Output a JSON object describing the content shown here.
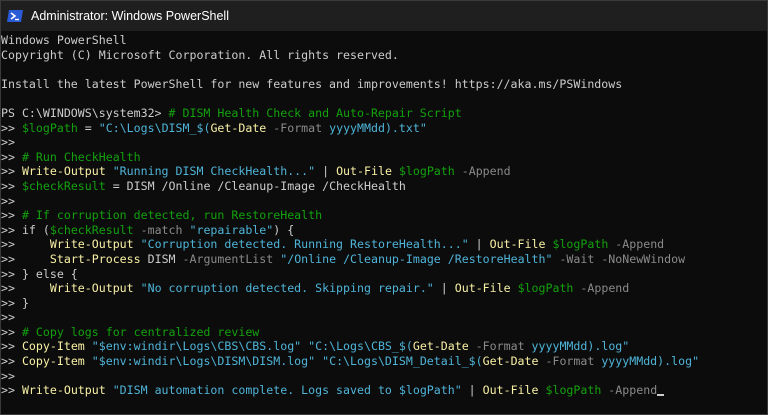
{
  "window": {
    "title": "Administrator: Windows PowerShell"
  },
  "colors": {
    "background": "#0c0c0c",
    "text": "#cccccc",
    "string": "#4fb4d8",
    "comment": "#13a10e",
    "command": "#f9f1a5",
    "parameter": "#8a8a8a",
    "variable": "#13a10e"
  },
  "console": {
    "lines": [
      [
        {
          "t": "Windows PowerShell",
          "c": "default"
        }
      ],
      [
        {
          "t": "Copyright (C) Microsoft Corporation. All rights reserved.",
          "c": "default"
        }
      ],
      [],
      [
        {
          "t": "Install the latest PowerShell for new features and improvements! https://aka.ms/PSWindows",
          "c": "default"
        }
      ],
      [],
      [
        {
          "t": "PS C:\\WINDOWS\\system32> ",
          "c": "default"
        },
        {
          "t": "# DISM Health Check and Auto-Repair Script",
          "c": "comment"
        }
      ],
      [
        {
          "t": ">> ",
          "c": "default"
        },
        {
          "t": "$logPath",
          "c": "var"
        },
        {
          "t": " = ",
          "c": "op"
        },
        {
          "t": "\"C:\\Logs\\DISM_$(",
          "c": "string"
        },
        {
          "t": "Get-Date",
          "c": "cmd"
        },
        {
          "t": " -Format",
          "c": "param"
        },
        {
          "t": " yyyyMMdd",
          "c": "string"
        },
        {
          "t": ").txt\"",
          "c": "string"
        }
      ],
      [
        {
          "t": ">>",
          "c": "default"
        }
      ],
      [
        {
          "t": ">> ",
          "c": "default"
        },
        {
          "t": "# Run CheckHealth",
          "c": "comment"
        }
      ],
      [
        {
          "t": ">> ",
          "c": "default"
        },
        {
          "t": "Write-Output",
          "c": "cmd"
        },
        {
          "t": " \"Running DISM CheckHealth...\"",
          "c": "string"
        },
        {
          "t": " | ",
          "c": "op"
        },
        {
          "t": "Out-File",
          "c": "cmd"
        },
        {
          "t": " $logPath",
          "c": "var"
        },
        {
          "t": " -Append",
          "c": "param"
        }
      ],
      [
        {
          "t": ">> ",
          "c": "default"
        },
        {
          "t": "$checkResult",
          "c": "var"
        },
        {
          "t": " = DISM /Online /Cleanup-Image /CheckHealth",
          "c": "op"
        }
      ],
      [
        {
          "t": ">>",
          "c": "default"
        }
      ],
      [
        {
          "t": ">> ",
          "c": "default"
        },
        {
          "t": "# If corruption detected, run RestoreHealth",
          "c": "comment"
        }
      ],
      [
        {
          "t": ">> if (",
          "c": "default"
        },
        {
          "t": "$checkResult",
          "c": "var"
        },
        {
          "t": " -match",
          "c": "param"
        },
        {
          "t": " \"repairable\"",
          "c": "string"
        },
        {
          "t": ") {",
          "c": "op"
        }
      ],
      [
        {
          "t": ">>     ",
          "c": "default"
        },
        {
          "t": "Write-Output",
          "c": "cmd"
        },
        {
          "t": " \"Corruption detected. Running RestoreHealth...\"",
          "c": "string"
        },
        {
          "t": " | ",
          "c": "op"
        },
        {
          "t": "Out-File",
          "c": "cmd"
        },
        {
          "t": " $logPath",
          "c": "var"
        },
        {
          "t": " -Append",
          "c": "param"
        }
      ],
      [
        {
          "t": ">>     ",
          "c": "default"
        },
        {
          "t": "Start-Process",
          "c": "cmd"
        },
        {
          "t": " DISM",
          "c": "op"
        },
        {
          "t": " -ArgumentList",
          "c": "param"
        },
        {
          "t": " \"/Online /Cleanup-Image /RestoreHealth\"",
          "c": "string"
        },
        {
          "t": " -Wait -NoNewWindow",
          "c": "param"
        }
      ],
      [
        {
          "t": ">> } else {",
          "c": "default"
        }
      ],
      [
        {
          "t": ">>     ",
          "c": "default"
        },
        {
          "t": "Write-Output",
          "c": "cmd"
        },
        {
          "t": " \"No corruption detected. Skipping repair.\"",
          "c": "string"
        },
        {
          "t": " | ",
          "c": "op"
        },
        {
          "t": "Out-File",
          "c": "cmd"
        },
        {
          "t": " $logPath",
          "c": "var"
        },
        {
          "t": " -Append",
          "c": "param"
        }
      ],
      [
        {
          "t": ">> }",
          "c": "default"
        }
      ],
      [
        {
          "t": ">>",
          "c": "default"
        }
      ],
      [
        {
          "t": ">> ",
          "c": "default"
        },
        {
          "t": "# Copy logs for centralized review",
          "c": "comment"
        }
      ],
      [
        {
          "t": ">> ",
          "c": "default"
        },
        {
          "t": "Copy-Item",
          "c": "cmd"
        },
        {
          "t": " \"$env:windir\\Logs\\CBS\\CBS.log\"",
          "c": "string"
        },
        {
          "t": " \"C:\\Logs\\CBS_$(",
          "c": "string"
        },
        {
          "t": "Get-Date",
          "c": "cmd"
        },
        {
          "t": " -Format",
          "c": "param"
        },
        {
          "t": " yyyyMMdd",
          "c": "string"
        },
        {
          "t": ").log\"",
          "c": "string"
        }
      ],
      [
        {
          "t": ">> ",
          "c": "default"
        },
        {
          "t": "Copy-Item",
          "c": "cmd"
        },
        {
          "t": " \"$env:windir\\Logs\\DISM\\DISM.log\"",
          "c": "string"
        },
        {
          "t": " \"C:\\Logs\\DISM_Detail_$(",
          "c": "string"
        },
        {
          "t": "Get-Date",
          "c": "cmd"
        },
        {
          "t": " -Format",
          "c": "param"
        },
        {
          "t": " yyyyMMdd",
          "c": "string"
        },
        {
          "t": ").log\"",
          "c": "string"
        }
      ],
      [
        {
          "t": ">>",
          "c": "default"
        }
      ],
      [
        {
          "t": ">> ",
          "c": "default"
        },
        {
          "t": "Write-Output",
          "c": "cmd"
        },
        {
          "t": " \"DISM automation complete. Logs saved to $logPath\"",
          "c": "string"
        },
        {
          "t": " | ",
          "c": "op"
        },
        {
          "t": "Out-File",
          "c": "cmd"
        },
        {
          "t": " $logPath",
          "c": "var"
        },
        {
          "t": " -Append",
          "c": "param"
        }
      ]
    ]
  }
}
